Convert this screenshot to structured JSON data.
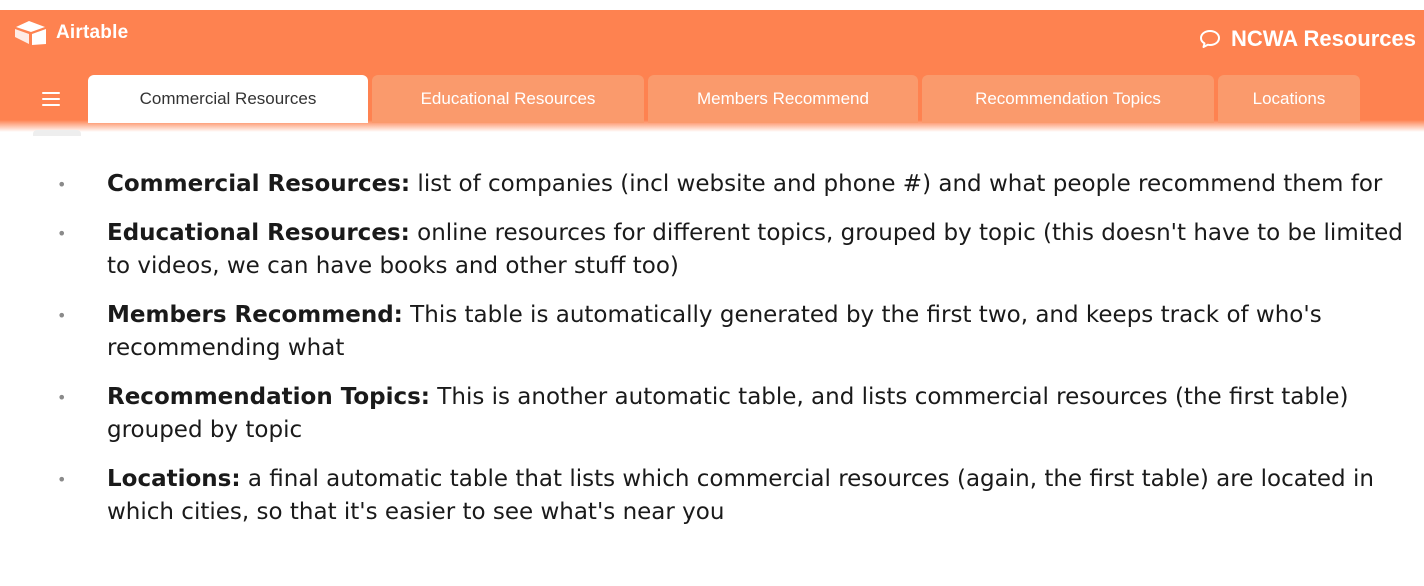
{
  "app": {
    "logo_text": "Airtable",
    "base_name": "NCWA Resources",
    "brand_color": "#fe8250",
    "icons": {
      "logo": "airtable-logo",
      "menu": "hamburger-menu-icon",
      "base": "chat-bubble-icon"
    }
  },
  "tabs": [
    {
      "label": "Commercial Resources",
      "active": true
    },
    {
      "label": "Educational Resources",
      "active": false
    },
    {
      "label": "Members Recommend",
      "active": false
    },
    {
      "label": "Recommendation Topics",
      "active": false
    },
    {
      "label": "Locations",
      "active": false
    }
  ],
  "descriptions": [
    {
      "term": "Commercial Resources:",
      "text": " list of companies (incl website and phone #) and what people recommend them for"
    },
    {
      "term": "Educational Resources:",
      "text": " online resources for different topics, grouped by topic (this doesn't have to be limited to videos, we can have books and other stuff too)"
    },
    {
      "term": "Members Recommend:",
      "text": " This table is automatically generated by the first two, and keeps track of who's recommending what"
    },
    {
      "term": "Recommendation Topics:",
      "text": " This is another automatic table, and lists commercial resources (the first table) grouped by topic"
    },
    {
      "term": "Locations:",
      "text": " a final automatic table that lists which commercial resources (again, the first table) are located in which cities, so that it's easier to see what's near you"
    }
  ]
}
